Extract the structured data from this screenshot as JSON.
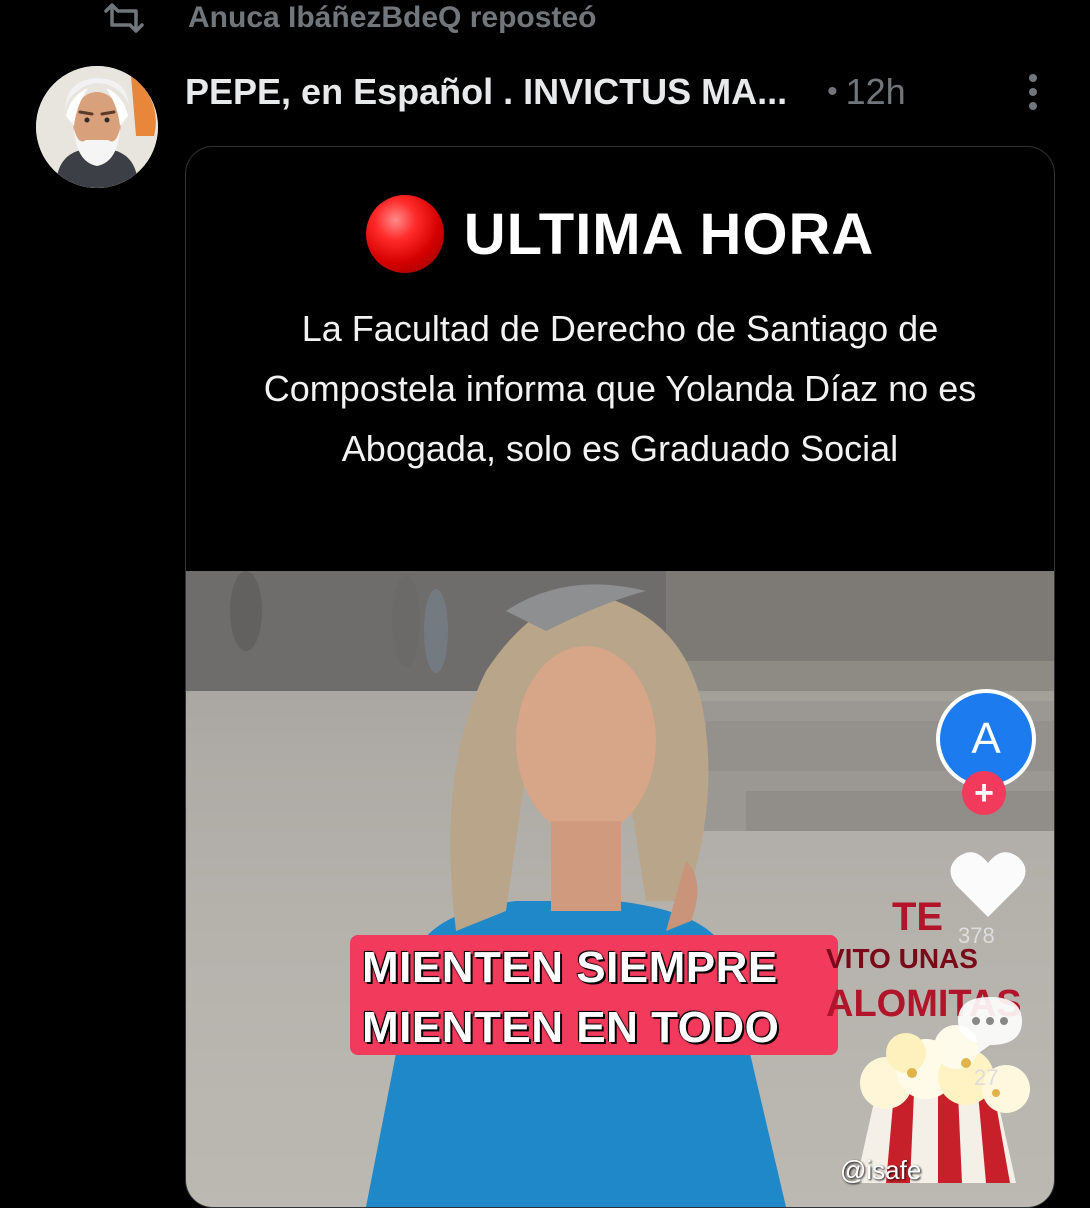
{
  "repost": {
    "icon": "repost-icon",
    "text": "Anuca IbáñezBdeQ reposteó"
  },
  "post": {
    "author": "PEPE, en Español . INVICTUS MA...",
    "separator": "•",
    "time": "12h",
    "more_icon": "more-vertical-icon"
  },
  "media": {
    "headline": "ULTIMA HORA",
    "subtext": "La Facultad de Derecho de Santiago de Compostela informa que Yolanda Díaz no es Abogada, solo es Graduado Social",
    "banner_line1": "MIENTEN SIEMPRE",
    "banner_line2": "MIENTEN EN TODO",
    "follow_avatar_letter": "A",
    "follow_plus": "+",
    "likes": "378",
    "comments": "27",
    "sticker_te": "TE",
    "sticker_vito": "VITO UNAS",
    "sticker_alomitas": "ALOMITAS",
    "watermark": "@isafe"
  },
  "colors": {
    "background": "#000000",
    "secondary_text": "#71767b",
    "banner": "#f23a5c",
    "follow_blue": "#1d7bf0"
  }
}
